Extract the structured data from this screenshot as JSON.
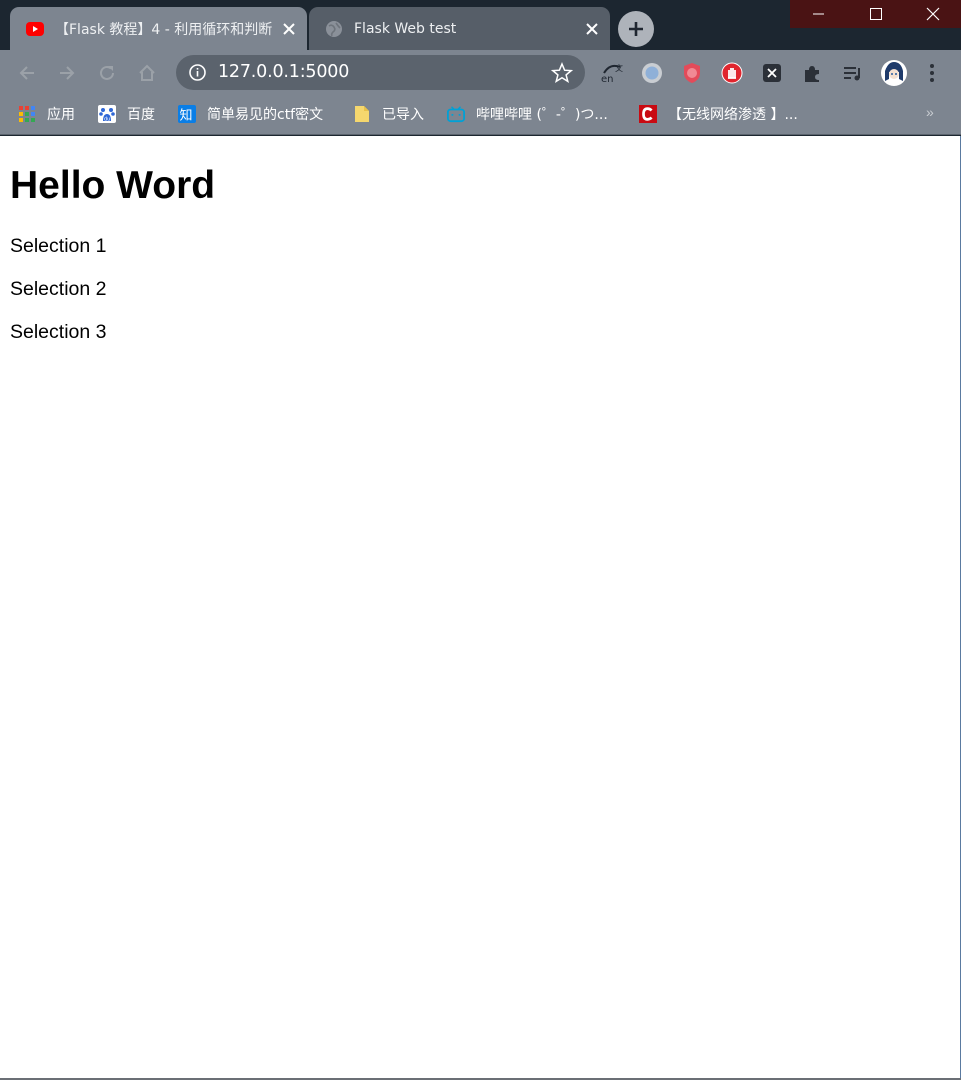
{
  "tabs": [
    {
      "title": "【Flask 教程】4 - 利用循环和判断",
      "favicon": "youtube-icon",
      "state": "active"
    },
    {
      "title": "Flask Web test",
      "favicon": "globe-icon",
      "state": "inactive"
    }
  ],
  "address_bar": {
    "url": "127.0.0.1:5000"
  },
  "bookmarks": [
    {
      "label": "应用",
      "icon": "apps-grid-icon"
    },
    {
      "label": "百度",
      "icon": "baidu-icon"
    },
    {
      "label": "简单易见的ctf密文",
      "icon": "zhihu-icon"
    },
    {
      "label": "已导入",
      "icon": "folder-icon"
    },
    {
      "label": "哔哩哔哩 (゜-゜)つ...",
      "icon": "bilibili-icon"
    },
    {
      "label": "【无线网络渗透 】...",
      "icon": "csdn-icon"
    }
  ],
  "bookmarks_overflow": "»",
  "page": {
    "heading": "Hello Word",
    "selections": [
      "Selection 1",
      "Selection 2",
      "Selection 3"
    ]
  },
  "colors": {
    "frame": "#1c2630",
    "toolbar": "#7d8590",
    "omnibox": "#5b636d",
    "window_controls": "#4a1314"
  }
}
